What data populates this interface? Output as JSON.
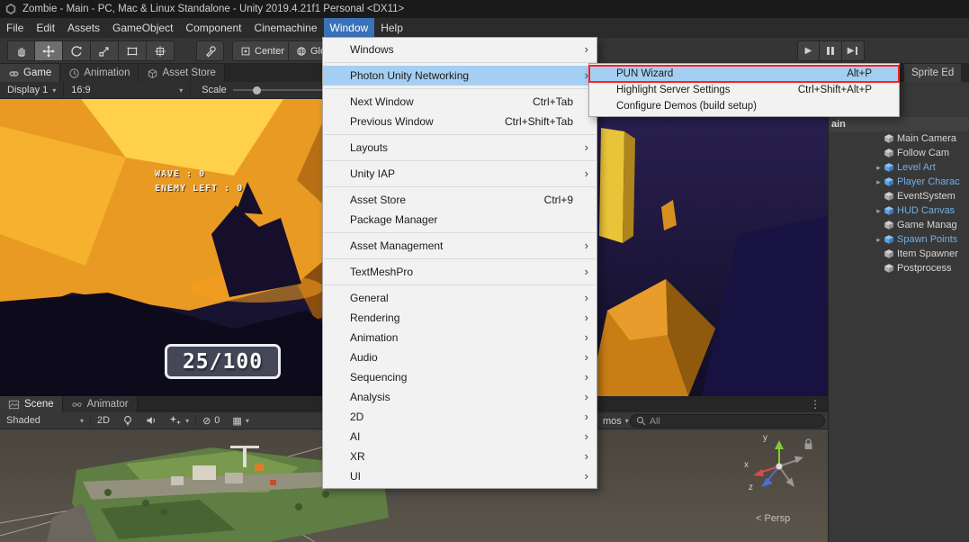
{
  "title_bar": {
    "title": "Zombie - Main - PC, Mac & Linux Standalone - Unity 2019.4.21f1 Personal <DX11>"
  },
  "menu_bar": {
    "items": [
      "File",
      "Edit",
      "Assets",
      "GameObject",
      "Component",
      "Cinemachine",
      "Window",
      "Help"
    ]
  },
  "toolbar": {
    "pivot_label": "Center",
    "space_label": "Global"
  },
  "window_menu": {
    "items": [
      {
        "label": "Windows"
      },
      {
        "label": "Photon Unity Networking"
      },
      {
        "label": "Next Window",
        "shortcut": "Ctrl+Tab"
      },
      {
        "label": "Previous Window",
        "shortcut": "Ctrl+Shift+Tab"
      },
      {
        "label": "Layouts"
      },
      {
        "label": "Unity IAP"
      },
      {
        "label": "Asset Store",
        "shortcut": "Ctrl+9"
      },
      {
        "label": "Package Manager"
      },
      {
        "label": "Asset Management"
      },
      {
        "label": "TextMeshPro"
      },
      {
        "label": "General"
      },
      {
        "label": "Rendering"
      },
      {
        "label": "Animation"
      },
      {
        "label": "Audio"
      },
      {
        "label": "Sequencing"
      },
      {
        "label": "Analysis"
      },
      {
        "label": "2D"
      },
      {
        "label": "AI"
      },
      {
        "label": "XR"
      },
      {
        "label": "UI"
      }
    ]
  },
  "pun_submenu": {
    "items": [
      {
        "label": "PUN Wizard",
        "shortcut": "Alt+P"
      },
      {
        "label": "Highlight Server Settings",
        "shortcut": "Ctrl+Shift+Alt+P"
      },
      {
        "label": "Configure Demos (build setup)"
      }
    ]
  },
  "view_tabs": {
    "game": "Game",
    "animation": "Animation",
    "asset_store": "Asset Store",
    "sprite_editor": "Sprite Ed"
  },
  "game_bar": {
    "display": "Display 1",
    "aspect": "16:9",
    "scale_label": "Scale"
  },
  "game_hud": {
    "wave": "WAVE : 0",
    "enemy_left": "ENEMY LEFT : 0",
    "health": "25/100"
  },
  "hierarchy": {
    "scene_name": "ain",
    "items": [
      {
        "label": "Main Camera"
      },
      {
        "label": "Follow Cam"
      },
      {
        "label": "Level Art"
      },
      {
        "label": "Player Charac"
      },
      {
        "label": "EventSystem"
      },
      {
        "label": "HUD Canvas"
      },
      {
        "label": "Game Manag"
      },
      {
        "label": "Spawn Points"
      },
      {
        "label": "Item Spawner"
      },
      {
        "label": "Postprocess"
      }
    ]
  },
  "bottom_tabs": {
    "scene": "Scene",
    "animator": "Animator"
  },
  "scene_bar": {
    "shaded": "Shaded",
    "mode_2d": "2D",
    "hidden_count": "0",
    "gizmos_partial": "mos",
    "search_value": "All"
  },
  "scene_view": {
    "axis_x": "x",
    "axis_y": "y",
    "axis_z": "z",
    "persp_label": "< Persp"
  },
  "icons": {
    "submenu_arrow": "›",
    "dropdown_arrow": "▾",
    "kebab": "⋮",
    "expand_arrow": "▸",
    "play": "▶",
    "hidden_toggle": "⊘",
    "grid": "▦"
  },
  "colors": {
    "menu_highlight": "#a5cff2",
    "annotation_red": "#ff1f1f",
    "prefab_blue": "#6fb0e8",
    "selected_tool": "#6e6e6e"
  }
}
